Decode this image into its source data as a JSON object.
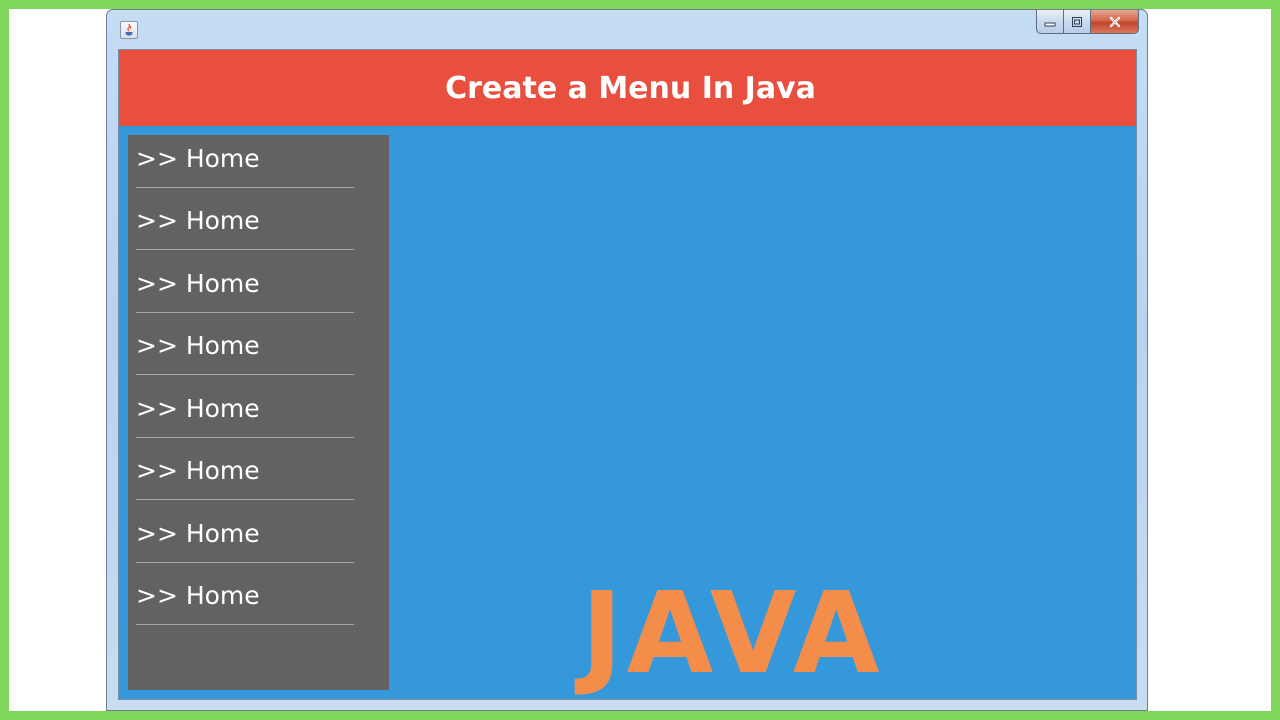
{
  "window": {
    "title": "",
    "controls": {
      "minimize_icon": "minimize-icon",
      "maximize_icon": "maximize-icon",
      "close_icon": "close-icon"
    }
  },
  "header": {
    "title": "Create a Menu In Java"
  },
  "menu": {
    "items": [
      {
        "label": ">> Home"
      },
      {
        "label": ">> Home"
      },
      {
        "label": ">> Home"
      },
      {
        "label": ">> Home"
      },
      {
        "label": ">> Home"
      },
      {
        "label": ">> Home"
      },
      {
        "label": ">> Home"
      },
      {
        "label": ">> Home"
      }
    ]
  },
  "content": {
    "logo_text": "JAVA"
  },
  "colors": {
    "header_bg": "#e94f3e",
    "content_bg": "#3598db",
    "sidebar_bg": "#626262",
    "logo_text": "#f58d4a",
    "page_border": "#7fd65a"
  }
}
